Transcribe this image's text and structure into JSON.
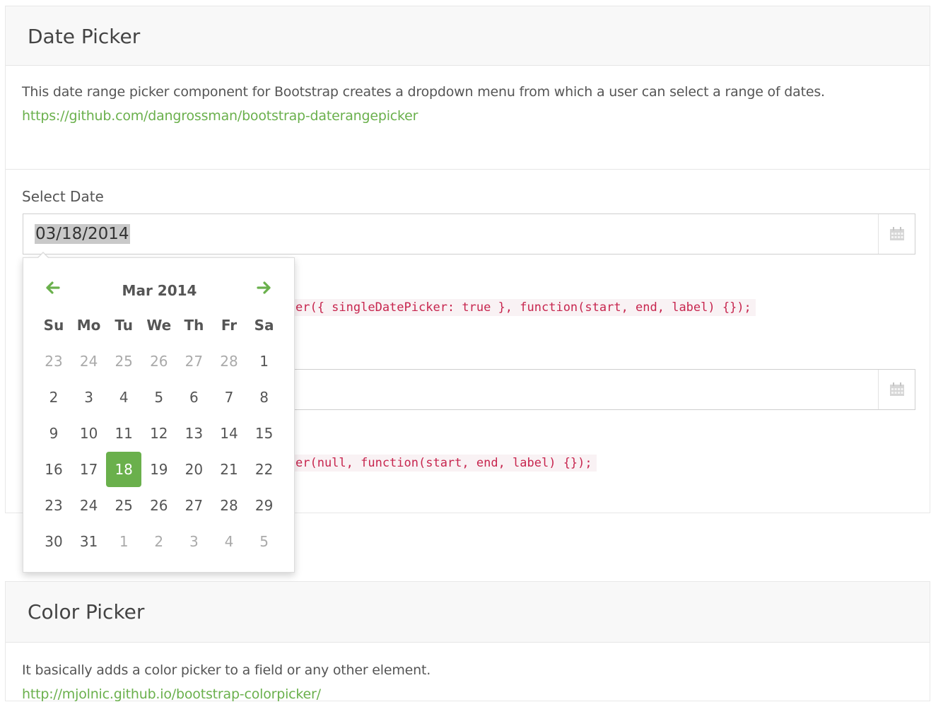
{
  "date_picker": {
    "title": "Date Picker",
    "description": "This date range picker component for Bootstrap creates a dropdown menu from which a user can select a range of dates.",
    "link": "https://github.com/dangrossman/bootstrap-daterangepicker",
    "select_label": "Select Date",
    "input_value": "03/18/2014",
    "code_single": "er({ singleDatePicker: true }, function(start, end, label) {});",
    "code_range": "er(null, function(start, end, label) {});"
  },
  "calendar": {
    "month_label": "Mar 2014",
    "prev_icon": "arrow-left-icon",
    "next_icon": "arrow-right-icon",
    "weekdays": [
      "Su",
      "Mo",
      "Tu",
      "We",
      "Th",
      "Fr",
      "Sa"
    ],
    "weeks": [
      [
        {
          "d": "23",
          "off": true
        },
        {
          "d": "24",
          "off": true
        },
        {
          "d": "25",
          "off": true
        },
        {
          "d": "26",
          "off": true
        },
        {
          "d": "27",
          "off": true
        },
        {
          "d": "28",
          "off": true
        },
        {
          "d": "1"
        }
      ],
      [
        {
          "d": "2"
        },
        {
          "d": "3"
        },
        {
          "d": "4"
        },
        {
          "d": "5"
        },
        {
          "d": "6"
        },
        {
          "d": "7"
        },
        {
          "d": "8"
        }
      ],
      [
        {
          "d": "9"
        },
        {
          "d": "10"
        },
        {
          "d": "11"
        },
        {
          "d": "12"
        },
        {
          "d": "13"
        },
        {
          "d": "14"
        },
        {
          "d": "15"
        }
      ],
      [
        {
          "d": "16"
        },
        {
          "d": "17"
        },
        {
          "d": "18",
          "active": true
        },
        {
          "d": "19"
        },
        {
          "d": "20"
        },
        {
          "d": "21"
        },
        {
          "d": "22"
        }
      ],
      [
        {
          "d": "23"
        },
        {
          "d": "24"
        },
        {
          "d": "25"
        },
        {
          "d": "26"
        },
        {
          "d": "27"
        },
        {
          "d": "28"
        },
        {
          "d": "29"
        }
      ],
      [
        {
          "d": "30"
        },
        {
          "d": "31"
        },
        {
          "d": "1",
          "off": true
        },
        {
          "d": "2",
          "off": true
        },
        {
          "d": "3",
          "off": true
        },
        {
          "d": "4",
          "off": true
        },
        {
          "d": "5",
          "off": true
        }
      ]
    ]
  },
  "color_picker": {
    "title": "Color Picker",
    "description": "It basically adds a color picker to a field or any other element.",
    "link": "http://mjolnic.github.io/bootstrap-colorpicker/"
  },
  "colors": {
    "accent": "#6ab04c",
    "code_text": "#c7254e",
    "code_bg": "#f9f2f4"
  }
}
